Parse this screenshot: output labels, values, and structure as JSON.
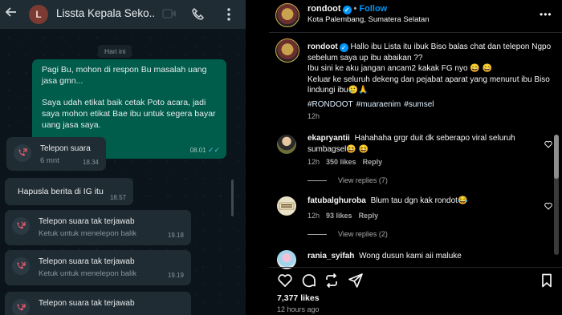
{
  "whatsapp": {
    "header": {
      "back_icon": "arrow-left-icon",
      "avatar_letter": "L",
      "contact_name": "Lissta Kepala Seko...",
      "video_icon": "video-camera-icon",
      "call_icon": "phone-icon",
      "menu_icon": "more-vertical-icon"
    },
    "date_divider": "Hari ini",
    "outgoing_message": {
      "paragraph1": "Pagi Bu, mohon di respon Bu masalah uang jasa gmn...",
      "paragraph2": "Saya udah etikat baik cetak Poto acara, jadi saya mohon etikat Bae ibu untuk segera bayar uang jasa saya.",
      "time": "08.01",
      "ticks": "✓✓"
    },
    "items": [
      {
        "type": "call",
        "title": "Telepon suara",
        "subtitle": "6 mnt",
        "time": "18.34"
      },
      {
        "type": "text",
        "text": "Hapusla berita di IG itu",
        "time": "18.57"
      },
      {
        "type": "missed",
        "title": "Telepon suara tak terjawab",
        "subtitle": "Ketuk untuk menelepon balik",
        "time": "19.18"
      },
      {
        "type": "missed",
        "title": "Telepon suara tak terjawab",
        "subtitle": "Ketuk untuk menelepon balik",
        "time": "19.19"
      },
      {
        "type": "missed",
        "title": "Telepon suara tak terjawab",
        "subtitle": "",
        "time": ""
      }
    ],
    "colors": {
      "outgoing": "#005c4b",
      "incoming": "#202c33",
      "missed_icon": "#f15c6d",
      "call_icon": "#f15c6d"
    }
  },
  "instagram": {
    "post_header": {
      "username": "rondoot",
      "follow_label": "Follow",
      "separator": "•",
      "location": "Kota Palembang, Sumatera Selatan",
      "more_icon": "more-horizontal-icon"
    },
    "caption": {
      "username": "rondoot",
      "line1": "Hallo ibu Lista itu ibuk Biso balas chat dan telepon Ngpo sebelum saya up ibu abaikan ??",
      "line2": "Ibu sini ke aku jangan ancam2 kakak FG nyo 😄 😄",
      "line3": "Keluar ke seluruh dekeng dan pejabat aparat yang menurut ibu Biso lindungi ibu🥲🙏",
      "hashtags": [
        "#RONDOOT",
        "#muaraenim",
        "#sumsel"
      ],
      "age": "12h"
    },
    "comments": [
      {
        "username": "ekapryantii",
        "text": "Hahahaha grgr duit dk seberapo viral seluruh sumbagsel😆 😆",
        "age": "12h",
        "likes": "350 likes",
        "reply": "Reply",
        "view_replies": "View replies (7)"
      },
      {
        "username": "fatubalghuroba",
        "text": "Blum tau dgn kak rondot😂",
        "age": "12h",
        "likes": "93 likes",
        "reply": "Reply",
        "view_replies": "View replies (2)"
      },
      {
        "username": "rania_syifah",
        "text": "Wong dusun kami aii maluke"
      }
    ],
    "actions": {
      "like_icon": "heart-icon",
      "comment_icon": "comment-icon",
      "share_icon": "repost-icon",
      "send_icon": "send-icon",
      "save_icon": "bookmark-icon"
    },
    "likes": "7,377 likes",
    "posted": "12 hours ago",
    "colors": {
      "accent": "#0095f6",
      "muted": "#a8a8a8"
    }
  }
}
